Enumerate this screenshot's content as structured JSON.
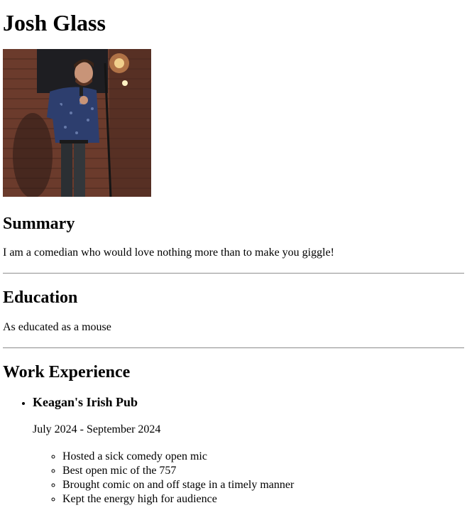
{
  "name": "Josh Glass",
  "photo_alt": "Josh Glass",
  "summary": {
    "heading": "Summary",
    "text": "I am a comedian who would love nothing more than to make you giggle!"
  },
  "education": {
    "heading": "Education",
    "text": "As educated as a mouse"
  },
  "work": {
    "heading": "Work Experience",
    "jobs": [
      {
        "title": "Keagan's Irish Pub",
        "dates": "July 2024 - September 2024",
        "duties": [
          "Hosted a sick comedy open mic",
          "Best open mic of the 757",
          "Brought comic on and off stage in a timely manner",
          "Kept the energy high for audience"
        ]
      }
    ]
  }
}
